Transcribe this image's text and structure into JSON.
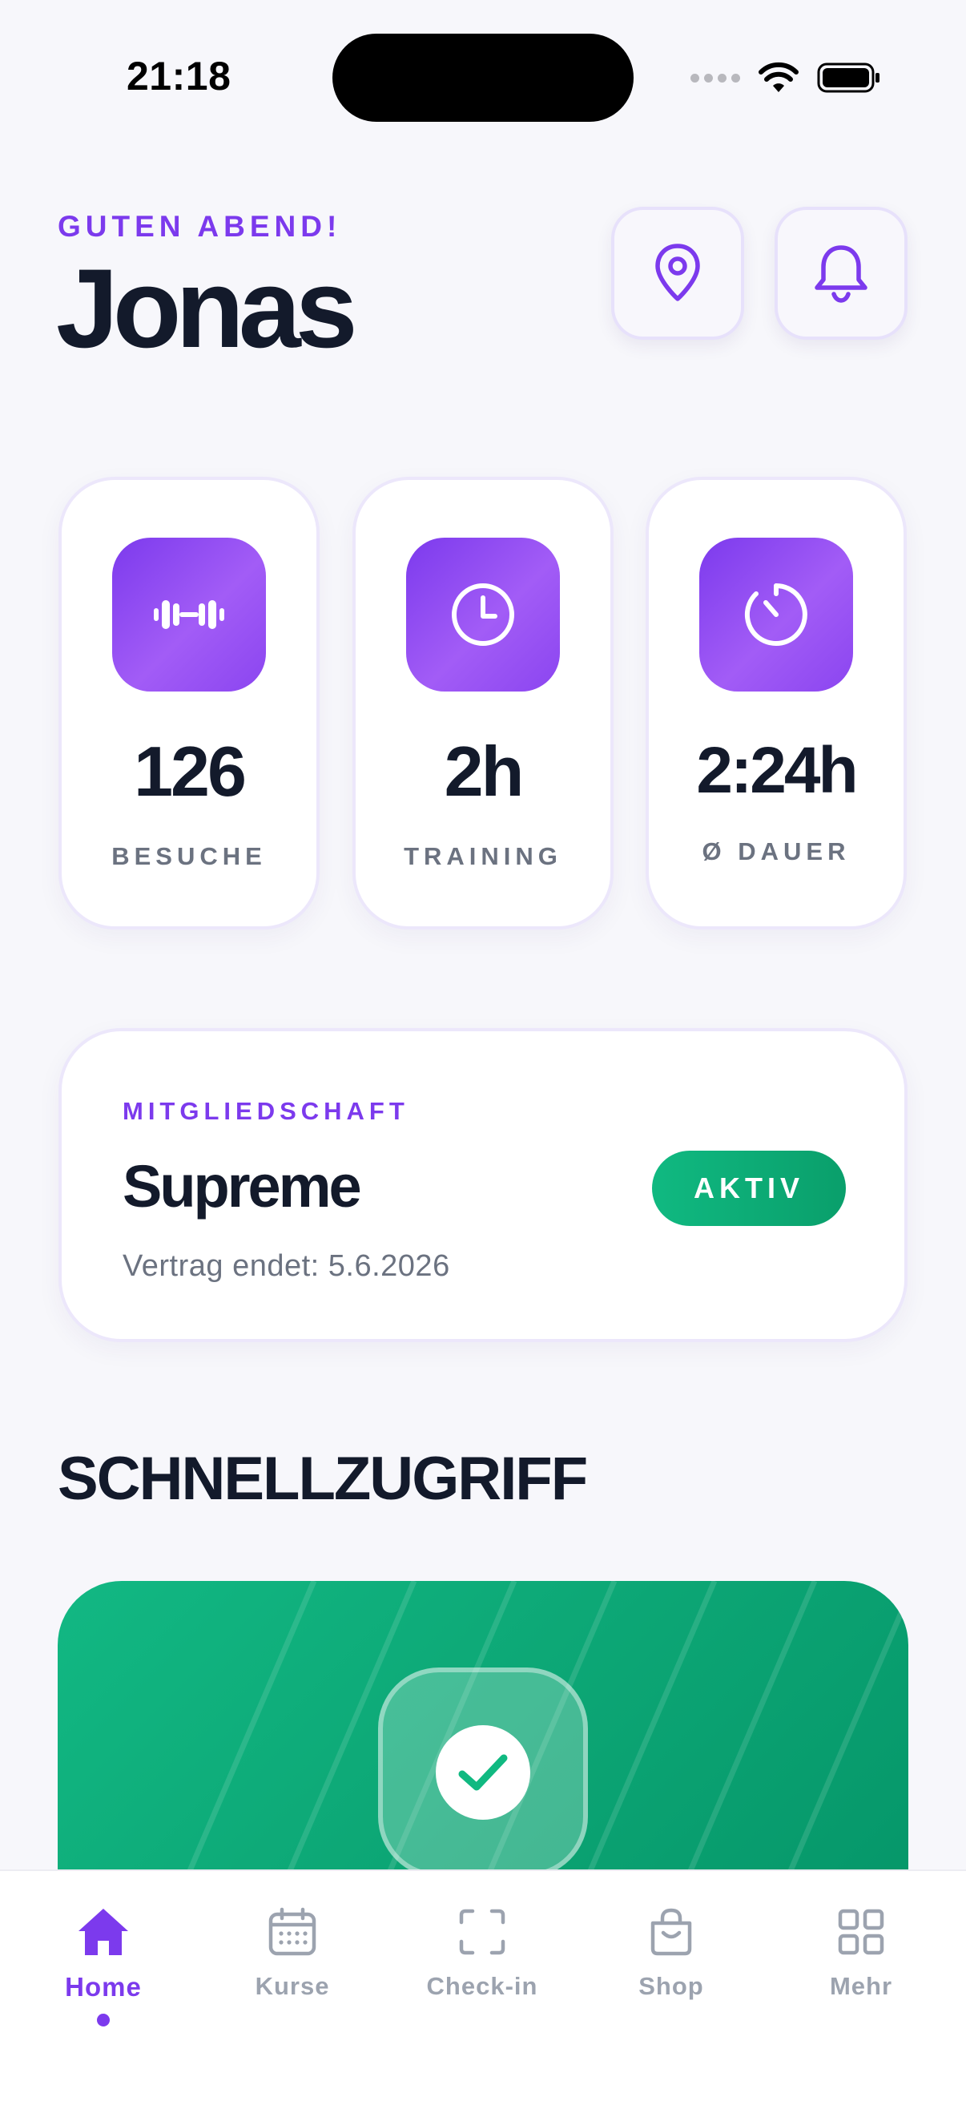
{
  "status_bar": {
    "time": "21:18"
  },
  "header": {
    "greeting": "GUTEN ABEND!",
    "user_name": "Jonas"
  },
  "stats": [
    {
      "icon": "dumbbell-icon",
      "value": "126",
      "label": "BESUCHE"
    },
    {
      "icon": "clock-icon",
      "value": "2h",
      "label": "TRAINING"
    },
    {
      "icon": "timer-icon",
      "value": "2:24h",
      "label": "Ø DAUER"
    }
  ],
  "membership": {
    "label": "MITGLIEDSCHAFT",
    "plan": "Supreme",
    "contract": "Vertrag endet: 5.6.2026",
    "status": "AKTIV"
  },
  "quick_access": {
    "title": "SCHNELLZUGRIFF"
  },
  "nav": [
    {
      "label": "Home",
      "icon": "home-icon",
      "active": true
    },
    {
      "label": "Kurse",
      "icon": "calendar-icon",
      "active": false
    },
    {
      "label": "Check-in",
      "icon": "scan-icon",
      "active": false
    },
    {
      "label": "Shop",
      "icon": "shopping-bag-icon",
      "active": false
    },
    {
      "label": "Mehr",
      "icon": "grid-icon",
      "active": false
    }
  ],
  "colors": {
    "accent": "#7c3aed",
    "success": "#10b981",
    "text": "#131a2b",
    "muted": "#6b7280",
    "background": "#f7f7fb"
  }
}
